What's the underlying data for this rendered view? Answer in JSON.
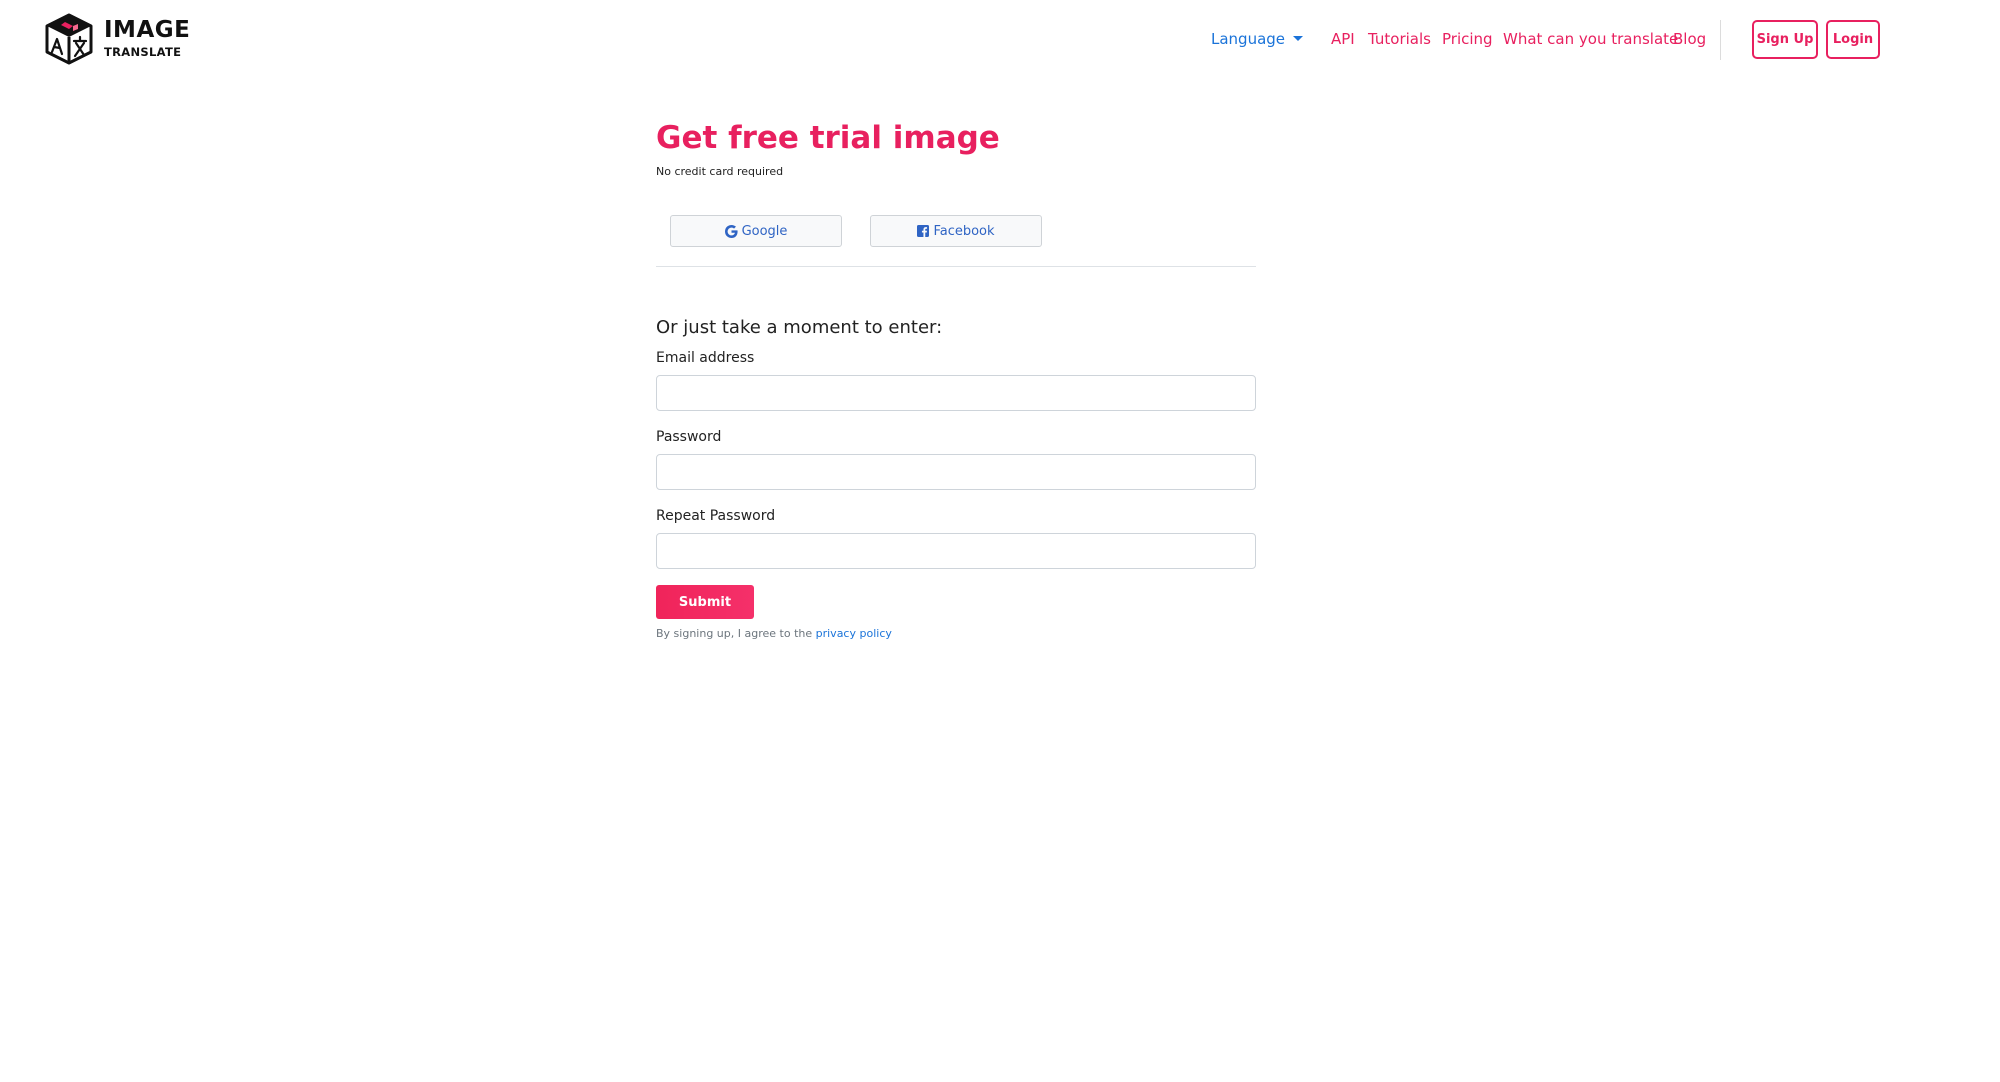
{
  "header": {
    "logo_line1": "IMAGE",
    "logo_line2": "TRANSLATE",
    "language_label": "Language",
    "nav_links": [
      "API",
      "Tutorials",
      "Pricing",
      "What can you translate",
      "Blog"
    ],
    "signup_label": "Sign Up",
    "login_label": "Login"
  },
  "main": {
    "title": "Get free trial image",
    "subtitle": "No credit card required",
    "google_label": "Google",
    "facebook_label": "Facebook",
    "form_heading": "Or just take a moment to enter:",
    "email_label": "Email address",
    "email_value": "",
    "password_label": "Password",
    "password_value": "",
    "repeat_password_label": "Repeat Password",
    "repeat_password_value": "",
    "submit_label": "Submit",
    "terms_text": "By signing up, I agree to the ",
    "privacy_link": "privacy policy"
  },
  "icons": {
    "logo": "image-translate-cube-logo",
    "language_caret": "caret-down-icon",
    "google": "google-g-icon",
    "facebook": "facebook-f-icon"
  },
  "colors": {
    "brand_pink": "#e8205f",
    "link_blue": "#1a73d9",
    "social_text": "#2f64c4"
  }
}
